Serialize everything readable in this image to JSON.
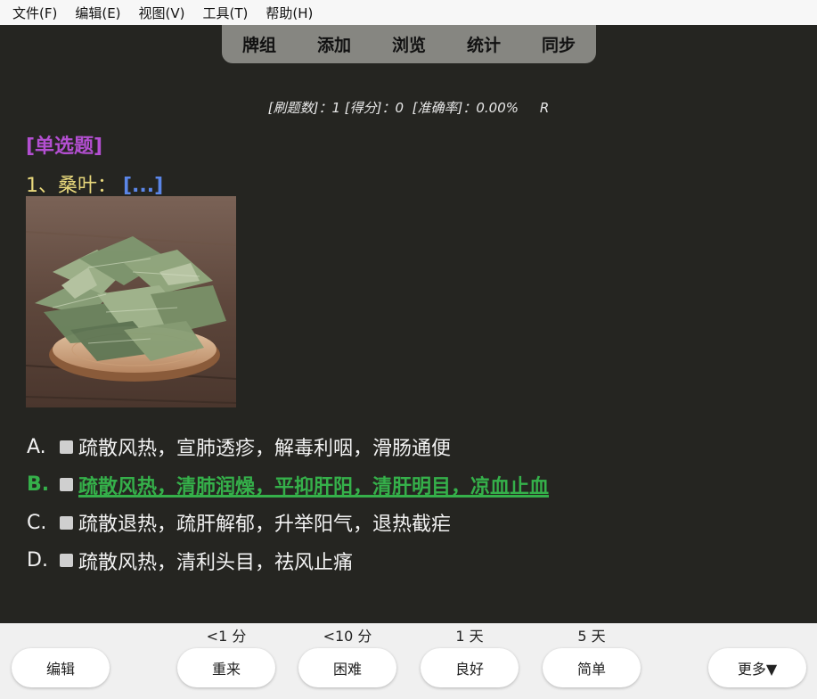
{
  "menu": {
    "items": [
      "文件(F)",
      "编辑(E)",
      "视图(V)",
      "工具(T)",
      "帮助(H)"
    ]
  },
  "nav": {
    "tabs": [
      "牌组",
      "添加",
      "浏览",
      "统计",
      "同步"
    ]
  },
  "stats": {
    "count_label": "[刷题数]",
    "count_value": "1",
    "score_label": "[得分]",
    "score_value": "0",
    "accuracy_label": "[准确率]",
    "accuracy_value": "0.00%",
    "extra": "R"
  },
  "question": {
    "type": "[单选题]",
    "prefix": "1、桑叶：",
    "cloze": "[...]",
    "options": [
      {
        "letter": "A.",
        "text": "疏散风热，宣肺透疹，解毒利咽，滑肠通便",
        "correct": false
      },
      {
        "letter": "B.",
        "text": "疏散风热，清肺润燥，平抑肝阳，清肝明目，凉血止血",
        "correct": true
      },
      {
        "letter": "C.",
        "text": "疏散退热，疏肝解郁，升举阳气，退热截疟",
        "correct": false
      },
      {
        "letter": "D.",
        "text": "疏散风热，清利头目，祛风止痛",
        "correct": false
      }
    ]
  },
  "answer_bar": {
    "edit_label": "编辑",
    "again": {
      "interval": "<1 分",
      "label": "重来"
    },
    "hard": {
      "interval": "<10 分",
      "label": "困难"
    },
    "good": {
      "interval": "1 天",
      "label": "良好"
    },
    "easy": {
      "interval": "5 天",
      "label": "简单"
    },
    "more_label": "更多▼"
  },
  "colors": {
    "background": "#252521",
    "type_label": "#b34fd1",
    "question_text": "#e8d87c",
    "cloze": "#5b86e8",
    "correct": "#35b04a"
  }
}
